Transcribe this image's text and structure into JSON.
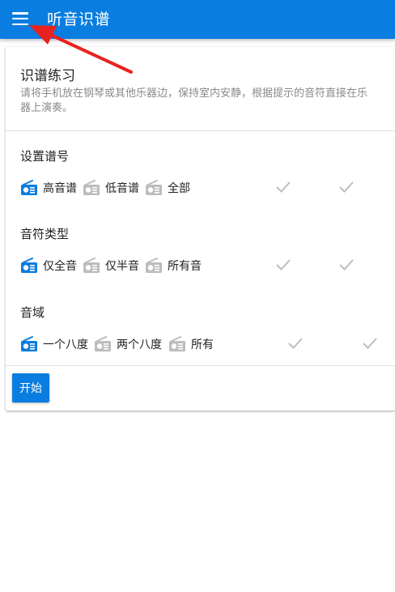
{
  "appbar": {
    "title": "听音识谱",
    "menu_icon": "menu-icon"
  },
  "card": {
    "title": "识谱练习",
    "description": "请将手机放在钢琴或其他乐器边，保持室内安静，根据提示的音符直接在乐器上演奏。"
  },
  "sections": [
    {
      "label": "设置谱号",
      "options": [
        "高音谱",
        "低音谱",
        "全部"
      ],
      "selected_index": 0
    },
    {
      "label": "音符类型",
      "options": [
        "仅全音",
        "仅半音",
        "所有音"
      ],
      "selected_index": 0
    },
    {
      "label": "音域",
      "options": [
        "一个八度",
        "两个八度",
        "所有"
      ],
      "selected_index": 0
    }
  ],
  "start_button": {
    "label": "开始"
  },
  "colors": {
    "primary": "#0a7de0",
    "icon_inactive": "#bdbdbd",
    "check": "#bdbdbd",
    "annotation_arrow": "#e8221f"
  }
}
